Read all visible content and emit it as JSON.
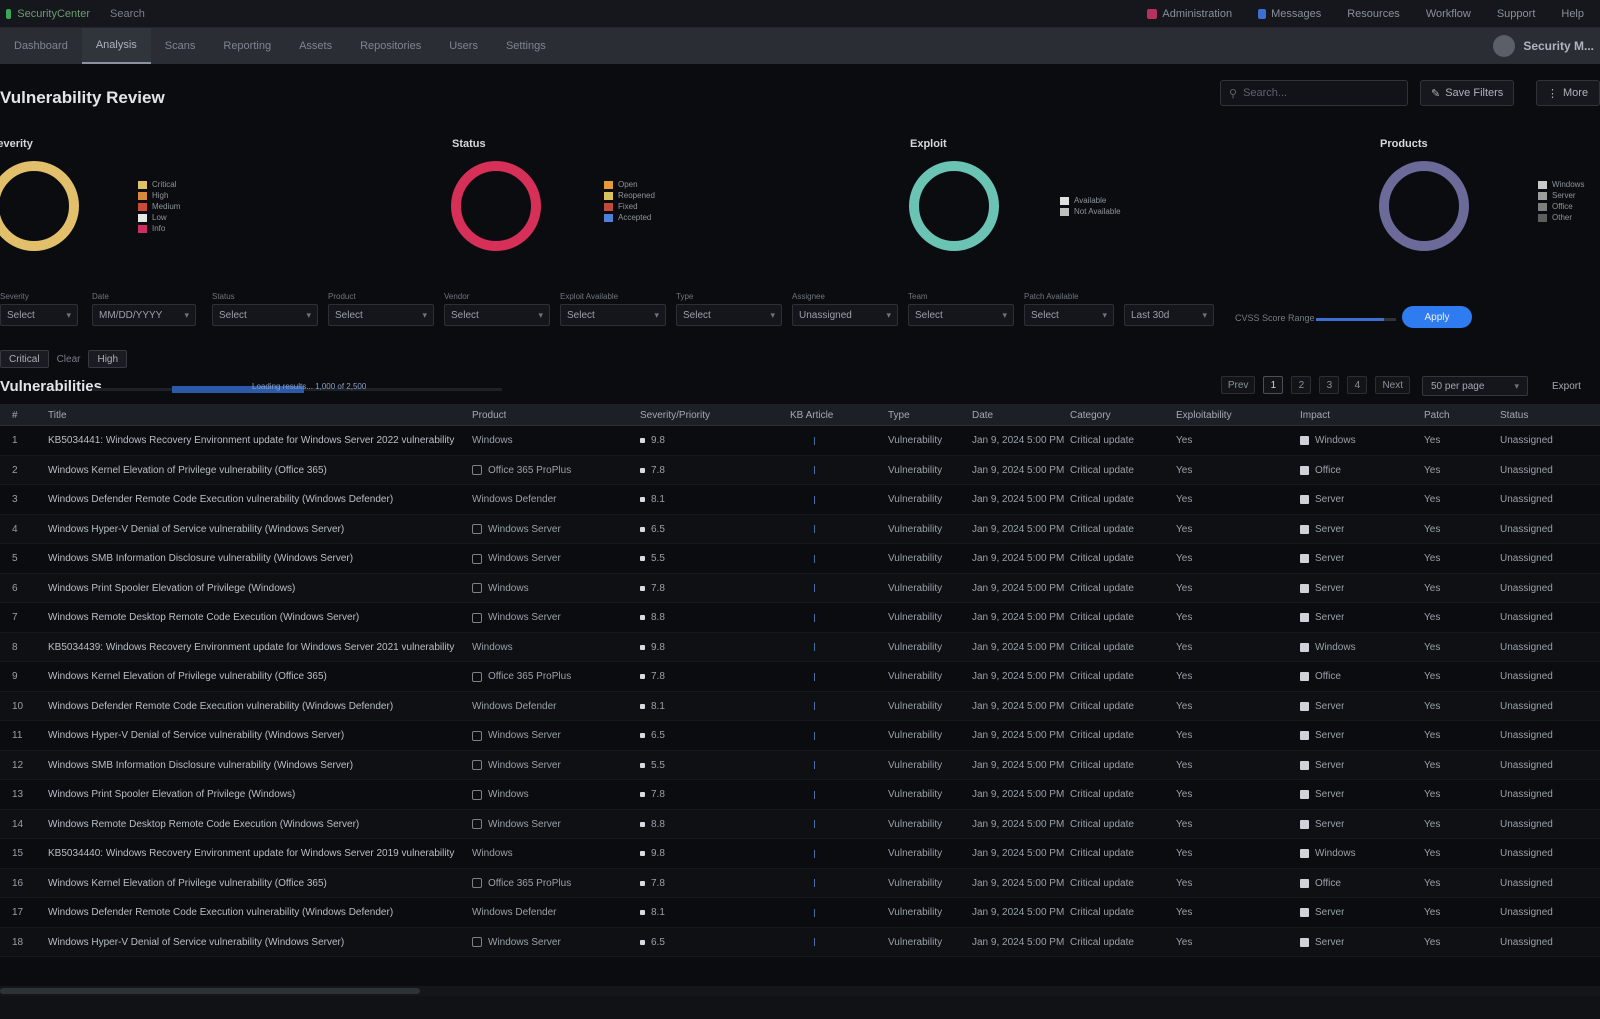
{
  "app": {
    "name": "SecurityCenter",
    "search_label": "Search"
  },
  "top_right": {
    "items": [
      "Administration",
      "Messages",
      "Resources",
      "Workflow",
      "Support",
      "Help"
    ]
  },
  "nav": {
    "tabs": [
      "Dashboard",
      "Analysis",
      "Scans",
      "Reporting",
      "Assets",
      "Repositories",
      "Users",
      "Settings"
    ],
    "active": 1
  },
  "user": {
    "name": "Security M..."
  },
  "page": {
    "title": "Vulnerability Review",
    "search_placeholder": "Search...",
    "btn_save": "Save Filters",
    "btn_more": "More"
  },
  "charts": [
    {
      "title": "Severity",
      "color": "#e2c06b",
      "legend": [
        {
          "label": "Critical",
          "color": "#e2c06b"
        },
        {
          "label": "High",
          "color": "#d9893a"
        },
        {
          "label": "Medium",
          "color": "#c94b3a"
        },
        {
          "label": "Low",
          "color": "#e6e6e6"
        },
        {
          "label": "Info",
          "color": "#cf2e62"
        }
      ]
    },
    {
      "title": "Status",
      "color": "#d62f58",
      "legend": [
        {
          "label": "Open",
          "color": "#e59a3a"
        },
        {
          "label": "Reopened",
          "color": "#d9c25a"
        },
        {
          "label": "Fixed",
          "color": "#c04a3c"
        },
        {
          "label": "Accepted",
          "color": "#4f7fd6"
        }
      ]
    },
    {
      "title": "Exploit",
      "color": "#6bc3b4",
      "legend": [
        {
          "label": "Available",
          "color": "#e0e0e0"
        },
        {
          "label": "Not Available",
          "color": "#bfbfbf"
        }
      ]
    },
    {
      "title": "Products",
      "color": "#6c6a98",
      "legend": [
        {
          "label": "Windows",
          "color": "#c9c9c9"
        },
        {
          "label": "Server",
          "color": "#9e9e9e"
        },
        {
          "label": "Office",
          "color": "#7e7e7e"
        },
        {
          "label": "Other",
          "color": "#5e5e5e"
        }
      ]
    }
  ],
  "filters": [
    {
      "label": "Severity",
      "value": "Select"
    },
    {
      "label": "Date",
      "value": "MM/DD/YYYY"
    },
    {
      "label": "Status",
      "value": "Select"
    },
    {
      "label": "Product",
      "value": "Select"
    },
    {
      "label": "Vendor",
      "value": "Select"
    },
    {
      "label": "Exploit Available",
      "value": "Select"
    },
    {
      "label": "Type",
      "value": "Select"
    },
    {
      "label": "Assignee",
      "value": "Unassigned"
    },
    {
      "label": "Team",
      "value": "Select"
    },
    {
      "label": "Patch Available",
      "value": "Select"
    },
    {
      "label": "",
      "value": "Last 30d"
    }
  ],
  "cvss": {
    "label": "CVSS Score Range",
    "value": 0.85,
    "apply": "Apply"
  },
  "chips": {
    "items": [
      "Critical",
      "High"
    ],
    "label": "Clear"
  },
  "section": {
    "title": "Vulnerabilities",
    "progress_text": "Loading results... 1,000 of 2,500",
    "progress": 0.4
  },
  "pager": {
    "prev": "Prev",
    "pages": [
      "1",
      "2",
      "3",
      "4"
    ],
    "next": "Next",
    "active": 0,
    "per_page": "50 per page",
    "export": "Export"
  },
  "table": {
    "columns": [
      "#",
      "Title",
      "Product",
      "Severity/Priority",
      "KB Article",
      "Type",
      "Date",
      "Category",
      "Exploitability",
      "Impact",
      "Patch",
      "Status"
    ],
    "rows": [
      {
        "n": "1",
        "title": "KB5034441: Windows Recovery Environment update for Windows Server 2022 vulnerability",
        "product": "Windows",
        "sev": "9.8",
        "type": "Vulnerability",
        "date": "Jan 9, 2024 5:00 PM",
        "category": "Critical update",
        "expl": "Yes",
        "impact": "Windows",
        "patch": "Yes",
        "status": "Unassigned",
        "icon": false
      },
      {
        "n": "2",
        "title": "Windows Kernel Elevation of Privilege vulnerability (Office 365)",
        "product": "Office 365 ProPlus",
        "sev": "7.8",
        "type": "Vulnerability",
        "date": "Jan 9, 2024 5:00 PM",
        "category": "Critical update",
        "expl": "Yes",
        "impact": "Office",
        "patch": "Yes",
        "status": "Unassigned",
        "icon": true
      },
      {
        "n": "3",
        "title": "Windows Defender Remote Code Execution vulnerability (Windows Defender)",
        "product": "Windows Defender",
        "sev": "8.1",
        "type": "Vulnerability",
        "date": "Jan 9, 2024 5:00 PM",
        "category": "Critical update",
        "expl": "Yes",
        "impact": "Server",
        "patch": "Yes",
        "status": "Unassigned",
        "icon": false
      },
      {
        "n": "4",
        "title": "Windows Hyper-V Denial of Service vulnerability (Windows Server)",
        "product": "Windows Server",
        "sev": "6.5",
        "type": "Vulnerability",
        "date": "Jan 9, 2024 5:00 PM",
        "category": "Critical update",
        "expl": "Yes",
        "impact": "Server",
        "patch": "Yes",
        "status": "Unassigned",
        "icon": true
      },
      {
        "n": "5",
        "title": "Windows SMB Information Disclosure vulnerability (Windows Server)",
        "product": "Windows Server",
        "sev": "5.5",
        "type": "Vulnerability",
        "date": "Jan 9, 2024 5:00 PM",
        "category": "Critical update",
        "expl": "Yes",
        "impact": "Server",
        "patch": "Yes",
        "status": "Unassigned",
        "icon": true
      },
      {
        "n": "6",
        "title": "Windows Print Spooler Elevation of Privilege (Windows)",
        "product": "Windows",
        "sev": "7.8",
        "type": "Vulnerability",
        "date": "Jan 9, 2024 5:00 PM",
        "category": "Critical update",
        "expl": "Yes",
        "impact": "Server",
        "patch": "Yes",
        "status": "Unassigned",
        "icon": true
      },
      {
        "n": "7",
        "title": "Windows Remote Desktop Remote Code Execution (Windows Server)",
        "product": "Windows Server",
        "sev": "8.8",
        "type": "Vulnerability",
        "date": "Jan 9, 2024 5:00 PM",
        "category": "Critical update",
        "expl": "Yes",
        "impact": "Server",
        "patch": "Yes",
        "status": "Unassigned",
        "icon": true
      },
      {
        "n": "8",
        "title": "KB5034439: Windows Recovery Environment update for Windows Server 2021 vulnerability",
        "product": "Windows",
        "sev": "9.8",
        "type": "Vulnerability",
        "date": "Jan 9, 2024 5:00 PM",
        "category": "Critical update",
        "expl": "Yes",
        "impact": "Windows",
        "patch": "Yes",
        "status": "Unassigned",
        "icon": false
      },
      {
        "n": "9",
        "title": "Windows Kernel Elevation of Privilege vulnerability (Office 365)",
        "product": "Office 365 ProPlus",
        "sev": "7.8",
        "type": "Vulnerability",
        "date": "Jan 9, 2024 5:00 PM",
        "category": "Critical update",
        "expl": "Yes",
        "impact": "Office",
        "patch": "Yes",
        "status": "Unassigned",
        "icon": true
      },
      {
        "n": "10",
        "title": "Windows Defender Remote Code Execution vulnerability (Windows Defender)",
        "product": "Windows Defender",
        "sev": "8.1",
        "type": "Vulnerability",
        "date": "Jan 9, 2024 5:00 PM",
        "category": "Critical update",
        "expl": "Yes",
        "impact": "Server",
        "patch": "Yes",
        "status": "Unassigned",
        "icon": false
      },
      {
        "n": "11",
        "title": "Windows Hyper-V Denial of Service vulnerability (Windows Server)",
        "product": "Windows Server",
        "sev": "6.5",
        "type": "Vulnerability",
        "date": "Jan 9, 2024 5:00 PM",
        "category": "Critical update",
        "expl": "Yes",
        "impact": "Server",
        "patch": "Yes",
        "status": "Unassigned",
        "icon": true
      },
      {
        "n": "12",
        "title": "Windows SMB Information Disclosure vulnerability (Windows Server)",
        "product": "Windows Server",
        "sev": "5.5",
        "type": "Vulnerability",
        "date": "Jan 9, 2024 5:00 PM",
        "category": "Critical update",
        "expl": "Yes",
        "impact": "Server",
        "patch": "Yes",
        "status": "Unassigned",
        "icon": true
      },
      {
        "n": "13",
        "title": "Windows Print Spooler Elevation of Privilege (Windows)",
        "product": "Windows",
        "sev": "7.8",
        "type": "Vulnerability",
        "date": "Jan 9, 2024 5:00 PM",
        "category": "Critical update",
        "expl": "Yes",
        "impact": "Server",
        "patch": "Yes",
        "status": "Unassigned",
        "icon": true
      },
      {
        "n": "14",
        "title": "Windows Remote Desktop Remote Code Execution (Windows Server)",
        "product": "Windows Server",
        "sev": "8.8",
        "type": "Vulnerability",
        "date": "Jan 9, 2024 5:00 PM",
        "category": "Critical update",
        "expl": "Yes",
        "impact": "Server",
        "patch": "Yes",
        "status": "Unassigned",
        "icon": true
      },
      {
        "n": "15",
        "title": "KB5034440: Windows Recovery Environment update for Windows Server 2019 vulnerability",
        "product": "Windows",
        "sev": "9.8",
        "type": "Vulnerability",
        "date": "Jan 9, 2024 5:00 PM",
        "category": "Critical update",
        "expl": "Yes",
        "impact": "Windows",
        "patch": "Yes",
        "status": "Unassigned",
        "icon": false
      },
      {
        "n": "16",
        "title": "Windows Kernel Elevation of Privilege vulnerability (Office 365)",
        "product": "Office 365 ProPlus",
        "sev": "7.8",
        "type": "Vulnerability",
        "date": "Jan 9, 2024 5:00 PM",
        "category": "Critical update",
        "expl": "Yes",
        "impact": "Office",
        "patch": "Yes",
        "status": "Unassigned",
        "icon": true
      },
      {
        "n": "17",
        "title": "Windows Defender Remote Code Execution vulnerability (Windows Defender)",
        "product": "Windows Defender",
        "sev": "8.1",
        "type": "Vulnerability",
        "date": "Jan 9, 2024 5:00 PM",
        "category": "Critical update",
        "expl": "Yes",
        "impact": "Server",
        "patch": "Yes",
        "status": "Unassigned",
        "icon": false
      },
      {
        "n": "18",
        "title": "Windows Hyper-V Denial of Service vulnerability (Windows Server)",
        "product": "Windows Server",
        "sev": "6.5",
        "type": "Vulnerability",
        "date": "Jan 9, 2024 5:00 PM",
        "category": "Critical update",
        "expl": "Yes",
        "impact": "Server",
        "patch": "Yes",
        "status": "Unassigned",
        "icon": true
      }
    ]
  }
}
